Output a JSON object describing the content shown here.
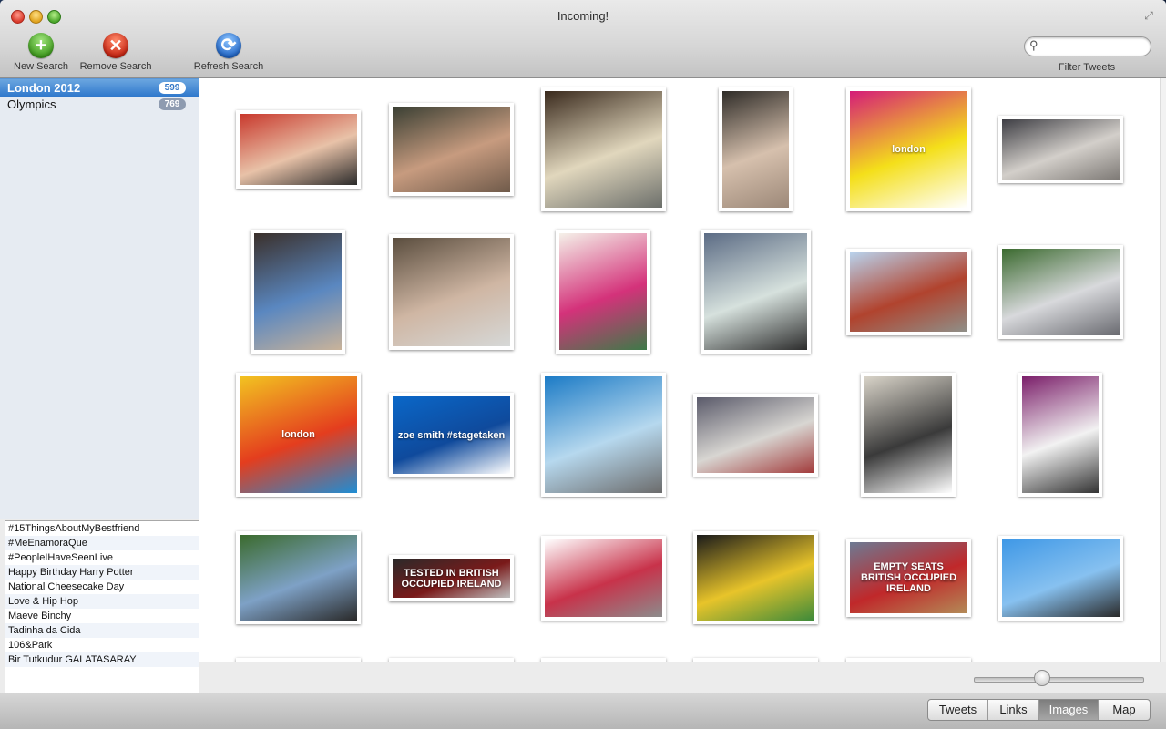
{
  "window": {
    "title": "Incoming!"
  },
  "toolbar": {
    "new_search": "New Search",
    "remove_search": "Remove Search",
    "refresh_search": "Refresh Search",
    "filter_label": "Filter Tweets",
    "filter_value": "",
    "new_icon": "plus-icon",
    "remove_icon": "x-icon",
    "refresh_icon": "refresh-icon"
  },
  "sidebar": {
    "searches": [
      {
        "name": "London 2012",
        "count": "599",
        "selected": true
      },
      {
        "name": "Olympics",
        "count": "769",
        "selected": false
      }
    ],
    "trends": [
      "#15ThingsAboutMyBestfriend",
      "#MeEnamoraQue",
      "#PeopleIHaveSeenLive",
      "Happy Birthday Harry Potter",
      "National Cheesecake Day",
      "Love & Hip Hop",
      "Maeve Binchy",
      "Tadinha da Cida",
      "106&Park",
      "Bir Tutkudur GALATASARAY"
    ]
  },
  "images": {
    "row1": [
      {
        "title": "medal-athlete",
        "caption": "",
        "colors": [
          "#c8382c",
          "#e8c2a8",
          "#2a2a2a"
        ]
      },
      {
        "title": "celebrity-with-fans",
        "caption": "",
        "colors": [
          "#3a3f33",
          "#c79b7f",
          "#6f5a4a"
        ]
      },
      {
        "title": "night-crowd-palace",
        "caption": "",
        "colors": [
          "#3a2a1d",
          "#e1d7bd",
          "#6b6e6a"
        ]
      },
      {
        "title": "two-people-portrait",
        "caption": "",
        "colors": [
          "#2f2c28",
          "#d6c0ad",
          "#9c8878"
        ]
      },
      {
        "title": "london-2012-logo-magenta",
        "caption": "london",
        "colors": [
          "#d51c78",
          "#f4df1a",
          "#ffffff"
        ]
      },
      {
        "title": "group-on-sofa",
        "caption": "",
        "colors": [
          "#3e3e44",
          "#d3cfca",
          "#7e7a76"
        ]
      }
    ],
    "row2": [
      {
        "title": "shop-visitors",
        "caption": "",
        "colors": [
          "#3a2f2a",
          "#5a87c0",
          "#c9b39a"
        ]
      },
      {
        "title": "selfie-with-fan",
        "caption": "",
        "colors": [
          "#5a4d3e",
          "#cfb6a3",
          "#d6d8d7"
        ]
      },
      {
        "title": "arabic-newspaper",
        "caption": "",
        "colors": [
          "#f5f1e9",
          "#d4327a",
          "#3d7a48"
        ]
      },
      {
        "title": "two-men-suits",
        "caption": "",
        "colors": [
          "#5b6b84",
          "#d6e1dd",
          "#2c2c2c"
        ]
      },
      {
        "title": "olympic-stadium-crowd",
        "caption": "",
        "colors": [
          "#b9d2ec",
          "#b1432e",
          "#8f8f88"
        ]
      },
      {
        "title": "street-with-van",
        "caption": "",
        "colors": [
          "#3b6a2f",
          "#d8d9dc",
          "#696a70"
        ]
      }
    ],
    "row3": [
      {
        "title": "london-2012-logo-yellow",
        "caption": "london",
        "colors": [
          "#f2c321",
          "#e43d1e",
          "#1f8dd4"
        ]
      },
      {
        "title": "zoe-smith-stagetaken",
        "caption": "zoe smith #stagetaken",
        "colors": [
          "#0a67c8",
          "#0f4a9c",
          "#ffffff"
        ]
      },
      {
        "title": "swimming-pool",
        "caption": "",
        "colors": [
          "#1c7bc6",
          "#b6d8ee",
          "#6b6b6b"
        ]
      },
      {
        "title": "athletes-embrace",
        "caption": "",
        "colors": [
          "#5a5a6a",
          "#d8d6d2",
          "#a23b3b"
        ]
      },
      {
        "title": "man-with-phone",
        "caption": "",
        "colors": [
          "#d8d3c8",
          "#3a3a3a",
          "#ffffff"
        ]
      },
      {
        "title": "medal-table-app",
        "caption": "",
        "colors": [
          "#7b1f6a",
          "#f2f2f2",
          "#333333"
        ]
      }
    ],
    "row4": [
      {
        "title": "tennis-centre-court",
        "caption": "",
        "colors": [
          "#3a6a2c",
          "#7ea1c6",
          "#2a2a2a"
        ]
      },
      {
        "title": "tested-in-british-occupied-ireland",
        "caption": "TESTED IN BRITISH OCCUPIED IRELAND",
        "colors": [
          "#2a2a2a",
          "#7a1a1a",
          "#bfbfbf"
        ]
      },
      {
        "title": "medal-table-list",
        "caption": "",
        "colors": [
          "#ffffff",
          "#c8324a",
          "#8c8c8c"
        ]
      },
      {
        "title": "team-parade",
        "caption": "",
        "colors": [
          "#1a1a1a",
          "#e8c42a",
          "#3d8a3a"
        ]
      },
      {
        "title": "empty-seats-stadium",
        "caption": "EMPTY SEATS BRITISH OCCUPIED IRELAND",
        "colors": [
          "#6d7a93",
          "#c0282a",
          "#b38b57"
        ]
      },
      {
        "title": "high-jump-athlete",
        "caption": "",
        "colors": [
          "#3f98e6",
          "#87c1f0",
          "#2a2a2a"
        ]
      }
    ],
    "row5": [
      {
        "title": "partial-image-1",
        "caption": "",
        "colors": [
          "#bfbfbf",
          "#e0e0e0",
          "#8a8a8a"
        ]
      },
      {
        "title": "partial-image-2",
        "caption": "",
        "colors": [
          "#d6d6d6",
          "#eeeeee",
          "#999999"
        ]
      },
      {
        "title": "partial-image-3",
        "caption": "",
        "colors": [
          "#111111",
          "#222222",
          "#333333"
        ]
      },
      {
        "title": "partial-image-4",
        "caption": "",
        "colors": [
          "#d8b99a",
          "#a37b5a",
          "#eeeeee"
        ]
      },
      {
        "title": "partial-image-5",
        "caption": "",
        "colors": [
          "#3a3a3a",
          "#8a8a8a",
          "#cccccc"
        ]
      }
    ]
  },
  "zoom": {
    "value": 0.4
  },
  "view_tabs": [
    {
      "label": "Tweets",
      "active": false
    },
    {
      "label": "Links",
      "active": false
    },
    {
      "label": "Images",
      "active": true
    },
    {
      "label": "Map",
      "active": false
    }
  ]
}
